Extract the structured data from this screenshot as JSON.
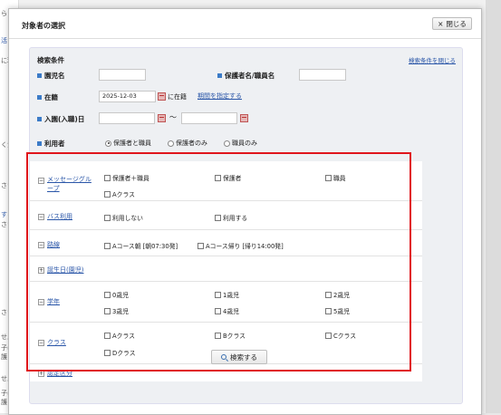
{
  "background": {
    "left_fragments": [
      "ら",
      "活",
      "に現",
      "くだ",
      "さい",
      "する",
      "さい",
      "さい",
      "せん",
      "子は",
      "護し",
      "せん",
      "子は",
      "護し"
    ]
  },
  "modal": {
    "title": "対象者の選択",
    "close_label": "閉じる",
    "close_glyph": "×"
  },
  "search": {
    "section_title": "検索条件",
    "collapse_link": "検索条件を閉じる",
    "child_name_label": "園児名",
    "guardian_name_label": "保護者名/職員名",
    "enrolled_label": "在籍",
    "enrolled_date": "2025-12-03",
    "enrolled_suffix": "に在籍",
    "period_link": "期間を指定する",
    "admission_label": "入園(入職)日",
    "range_sep": "〜",
    "user_label": "利用者",
    "user_options": [
      "保護者と職員",
      "保護者のみ",
      "職員のみ"
    ],
    "user_selected": "保護者と職員",
    "button_label": "検索する"
  },
  "filters": {
    "message_group": {
      "label": "メッセージグループ",
      "options": [
        "保護者＋職員",
        "保護者",
        "職員",
        "Aクラス"
      ]
    },
    "bus": {
      "label": "バス利用",
      "options": [
        "利用しない",
        "利用する"
      ]
    },
    "route": {
      "label": "路線",
      "options": [
        "Aコース朝 [朝07:30発]",
        "Aコース帰り [帰り14:00発]"
      ]
    },
    "birthday": {
      "label": "誕生日(園児)"
    },
    "grade": {
      "label": "学年",
      "options": [
        "0歳児",
        "1歳児",
        "2歳児",
        "3歳児",
        "4歳児",
        "5歳児"
      ]
    },
    "class": {
      "label": "クラス",
      "options": [
        "Aクラス",
        "Bクラス",
        "Cクラス",
        "Dクラス"
      ]
    },
    "certification": {
      "label": "認定区分"
    }
  },
  "toggle_glyphs": {
    "expanded": "−",
    "collapsed": "+"
  },
  "colors": {
    "accent": "#3b7bc7",
    "link": "#2a56a8",
    "highlight": "#e0151b"
  }
}
